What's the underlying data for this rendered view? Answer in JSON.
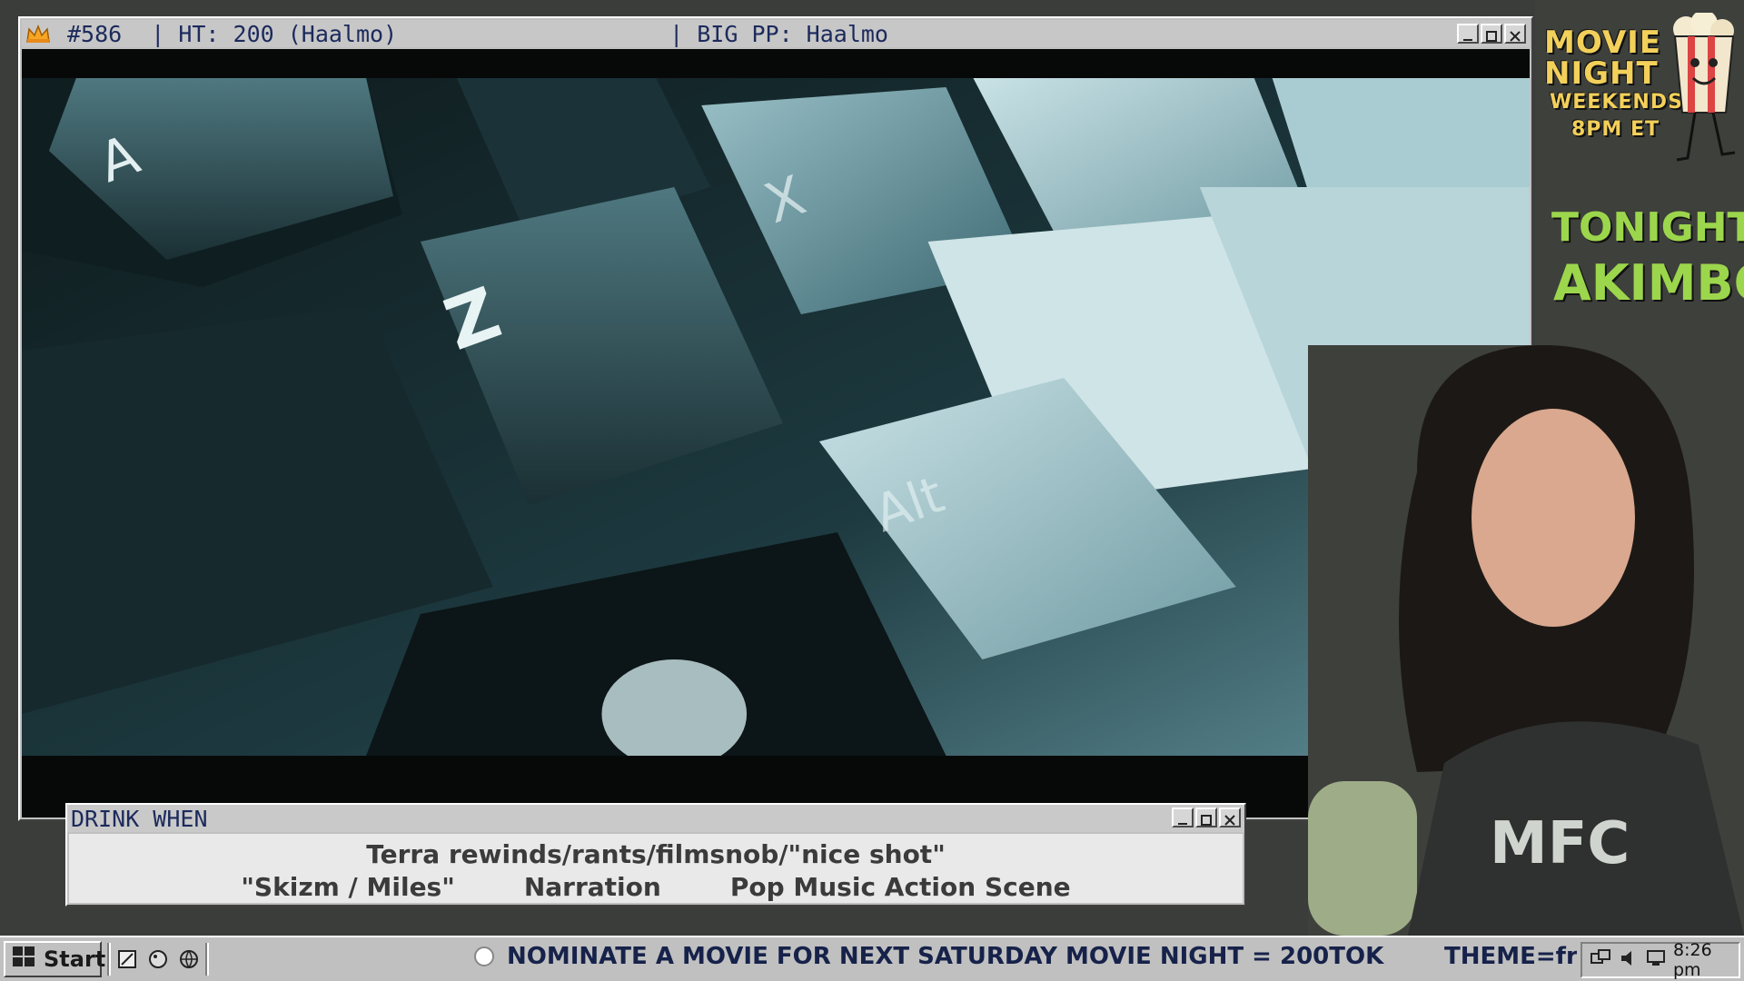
{
  "main_window": {
    "title_number": "#586",
    "title_ht": "| HT: 200 (Haalmo)",
    "title_pp": "| BIG PP: Haalmo",
    "icons": [
      "crown-icon",
      "minimize-icon",
      "maximize-icon",
      "close-icon"
    ]
  },
  "promo": {
    "line1": "MOVIE",
    "line2": "NIGHT",
    "line3": "WEEKENDS",
    "line4": "8PM ET",
    "tonight_label": "TONIGHT:",
    "tonight_title": "AKIMBO"
  },
  "drink_window": {
    "title": "DRINK WHEN",
    "line1": "Terra rewinds/rants/filmsnob/\"nice shot\"",
    "items": [
      "\"Skizm / Miles\"",
      "Narration",
      "Pop Music Action Scene"
    ]
  },
  "taskbar": {
    "start_label": "Start",
    "ticker": "NOMINATE A MOVIE FOR NEXT SATURDAY MOVIE NIGHT = 200TOK",
    "theme": "THEME=fre",
    "clock": "8:26 pm"
  },
  "colors": {
    "window_gray": "#c0c0c0",
    "title_text": "#1c2a5c",
    "promo_yellow": "#f2d05a",
    "promo_green": "#9cd64c"
  }
}
